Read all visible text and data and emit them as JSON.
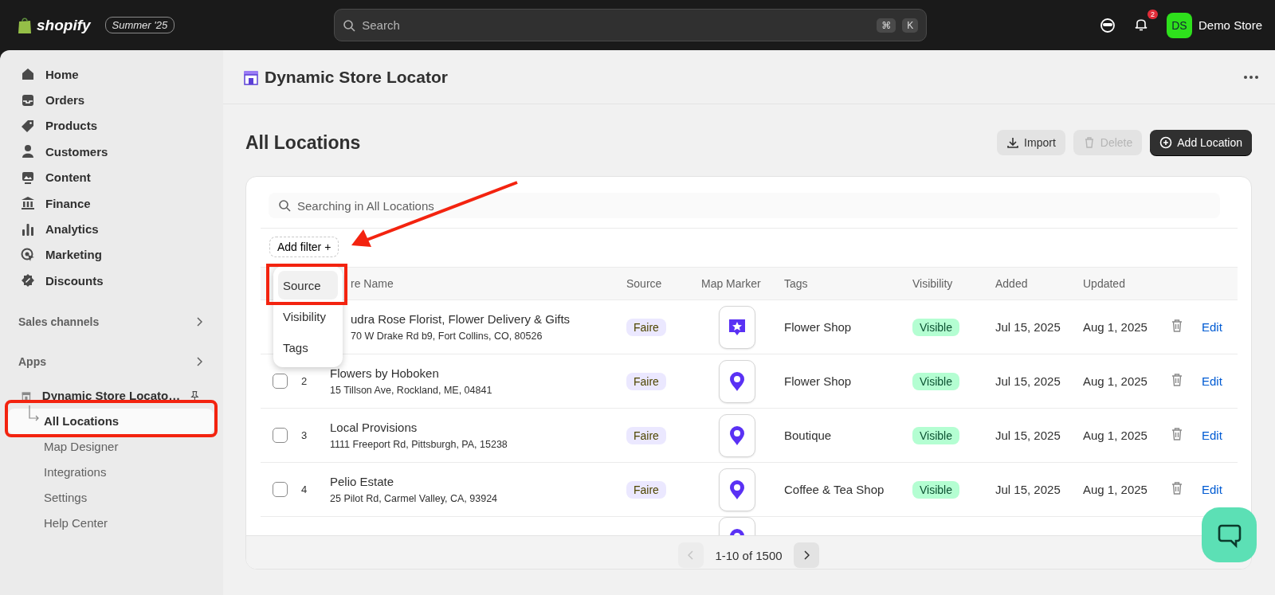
{
  "topbar": {
    "logo": "shopify",
    "edition": "Summer '25",
    "search": {
      "placeholder": "Search"
    },
    "shortcut": [
      "⌘",
      "K"
    ],
    "notifications": "2",
    "store": {
      "initials": "DS",
      "name": "Demo Store"
    }
  },
  "sidebar": {
    "items": [
      {
        "label": "Home"
      },
      {
        "label": "Orders"
      },
      {
        "label": "Products"
      },
      {
        "label": "Customers"
      },
      {
        "label": "Content"
      },
      {
        "label": "Finance"
      },
      {
        "label": "Analytics"
      },
      {
        "label": "Marketing"
      },
      {
        "label": "Discounts"
      }
    ],
    "sections": [
      {
        "label": "Sales channels"
      },
      {
        "label": "Apps"
      }
    ],
    "app": {
      "label": "Dynamic Store Locato…",
      "children": [
        {
          "label": "All Locations",
          "selected": true
        },
        {
          "label": "Map Designer",
          "selected": false
        },
        {
          "label": "Integrations",
          "selected": false
        },
        {
          "label": "Settings",
          "selected": false
        },
        {
          "label": "Help Center",
          "selected": false
        }
      ]
    }
  },
  "app_header": {
    "title": "Dynamic Store Locator"
  },
  "page": {
    "title": "All Locations",
    "actions": [
      {
        "label": "Import",
        "kind": "import",
        "disabled": false
      },
      {
        "label": "Delete",
        "kind": "delete",
        "disabled": true
      },
      {
        "label": "Add Location",
        "kind": "add",
        "disabled": false
      }
    ]
  },
  "search": {
    "placeholder": "Searching in All Locations"
  },
  "add_filter": {
    "label": "Add filter",
    "icon": "+"
  },
  "filter_menu": [
    {
      "label": "Source",
      "selected": true
    },
    {
      "label": "Visibility",
      "selected": false
    },
    {
      "label": "Tags",
      "selected": false
    }
  ],
  "table": {
    "columns": [
      "re Name",
      "Source",
      "Map Marker",
      "Tags",
      "Visibility",
      "Added",
      "Updated"
    ],
    "rows": [
      {
        "name": "udra Rose Florist, Flower Delivery & Gifts",
        "address": "70 W Drake Rd b9, Fort Collins, CO, 80526",
        "source": "Faire",
        "kind": "star",
        "tags": "Flower Shop",
        "visibility": "Visible",
        "added": "Jul 15, 2025",
        "updated": "Aug 1, 2025",
        "edit": "Edit"
      },
      {
        "checked": false,
        "number": "2",
        "name": "Flowers by Hoboken",
        "address": "15 Tillson Ave, Rockland, ME, 04841",
        "source": "Faire",
        "kind": "pin",
        "tags": "Flower Shop",
        "visibility": "Visible",
        "added": "Jul 15, 2025",
        "updated": "Aug 1, 2025",
        "edit": "Edit"
      },
      {
        "checked": false,
        "number": "3",
        "name": "Local Provisions",
        "address": "1111 Freeport Rd, Pittsburgh, PA, 15238",
        "source": "Faire",
        "kind": "pin",
        "tags": "Boutique",
        "visibility": "Visible",
        "added": "Jul 15, 2025",
        "updated": "Aug 1, 2025",
        "edit": "Edit"
      },
      {
        "checked": false,
        "number": "4",
        "name": "Pelio Estate",
        "address": "25 Pilot Rd, Carmel Valley, CA, 93924",
        "source": "Faire",
        "kind": "pin",
        "tags": "Coffee & Tea Shop",
        "visibility": "Visible",
        "added": "Jul 15, 2025",
        "updated": "Aug 1, 2025",
        "edit": "Edit"
      },
      {
        "kind": "pin"
      }
    ]
  },
  "pagination": {
    "range": "1-10 of 1500",
    "prev_disabled": true,
    "next_disabled": false
  },
  "annotations": [
    {
      "kind": "arrow"
    },
    {
      "kind": "filter-frame"
    },
    {
      "kind": "nav-frame"
    }
  ]
}
